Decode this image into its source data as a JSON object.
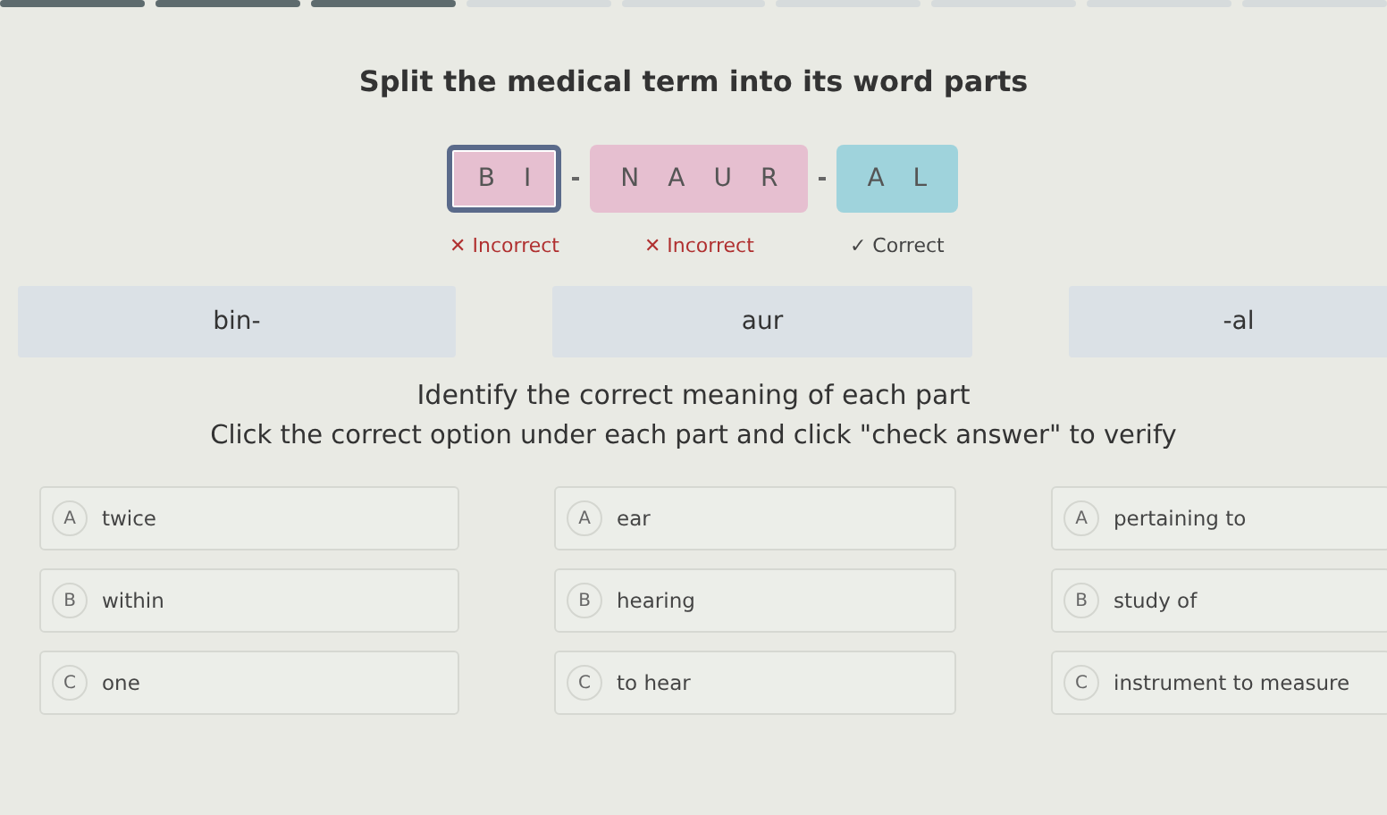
{
  "progress": [
    {
      "done": true
    },
    {
      "done": true
    },
    {
      "done": true
    },
    {
      "done": false
    },
    {
      "done": false
    },
    {
      "done": false
    },
    {
      "done": false
    },
    {
      "done": false
    },
    {
      "done": false
    }
  ],
  "title": "Split the medical term into its word parts",
  "tiles": [
    {
      "letters": [
        "B",
        "I"
      ],
      "correct": false,
      "selected": true,
      "feedback": "Incorrect",
      "mark": "✕"
    },
    {
      "letters": [
        "N",
        "A",
        "U",
        "R"
      ],
      "correct": false,
      "selected": false,
      "feedback": "Incorrect",
      "mark": "✕"
    },
    {
      "letters": [
        "A",
        "L"
      ],
      "correct": true,
      "selected": false,
      "feedback": "Correct",
      "mark": "✓"
    }
  ],
  "parts": [
    "bin-",
    "aur",
    "-al"
  ],
  "subtitle": "Identify the correct meaning of each part",
  "instruction": "Click the correct option under each part and click \"check answer\" to verify",
  "columns": [
    {
      "options": [
        {
          "letter": "A",
          "text": "twice"
        },
        {
          "letter": "B",
          "text": "within"
        },
        {
          "letter": "C",
          "text": "one"
        }
      ]
    },
    {
      "options": [
        {
          "letter": "A",
          "text": "ear"
        },
        {
          "letter": "B",
          "text": "hearing"
        },
        {
          "letter": "C",
          "text": "to hear"
        }
      ]
    },
    {
      "options": [
        {
          "letter": "A",
          "text": "pertaining to"
        },
        {
          "letter": "B",
          "text": "study of"
        },
        {
          "letter": "C",
          "text": "instrument to measure"
        }
      ]
    }
  ]
}
